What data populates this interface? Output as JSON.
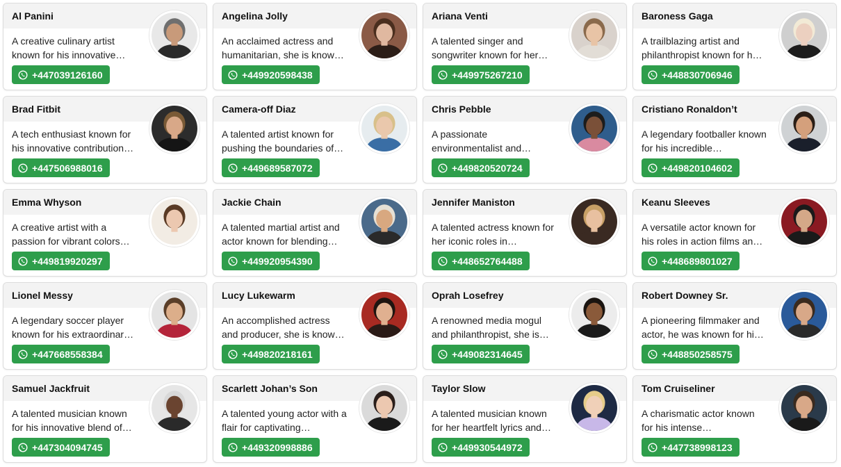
{
  "contacts": [
    {
      "name": "Al Panini",
      "description": "A creative culinary artist known for his innovative…",
      "phone": "+447039126160",
      "avatar_bg": "#e8e8e8",
      "skin": "#c89a7a",
      "hair": "#6f6f6f",
      "shirt": "#2a2a2a"
    },
    {
      "name": "Angelina Jolly",
      "description": "An acclaimed actress and humanitarian, she is know…",
      "phone": "+449920598438",
      "avatar_bg": "#8a5a46",
      "skin": "#e0b8a0",
      "hair": "#4a2e1e",
      "shirt": "#2b1d17"
    },
    {
      "name": "Ariana Venti",
      "description": "A talented singer and songwriter known for her…",
      "phone": "+449975267210",
      "avatar_bg": "#d9d2cc",
      "skin": "#e8c4a6",
      "hair": "#8a6a4c",
      "shirt": "#e2ddd6"
    },
    {
      "name": "Baroness Gaga",
      "description": "A trailblazing artist and philanthropist known for h…",
      "phone": "+448830706946",
      "avatar_bg": "#cfcfcf",
      "skin": "#ecd0c0",
      "hair": "#f2ead6",
      "shirt": "#1c1c1c"
    },
    {
      "name": "Brad Fitbit",
      "description": "A tech enthusiast known for his innovative contribution…",
      "phone": "+447506988016",
      "avatar_bg": "#2c2c2c",
      "skin": "#d8a888",
      "hair": "#7a5a36",
      "shirt": "#151515"
    },
    {
      "name": "Camera-off Diaz",
      "description": "A talented artist known for pushing the boundaries of…",
      "phone": "+449689587072",
      "avatar_bg": "#e6ecef",
      "skin": "#eac8ac",
      "hair": "#d8c08a",
      "shirt": "#3a6ea5"
    },
    {
      "name": "Chris Pebble",
      "description": "A passionate environmentalist and…",
      "phone": "+449820520724",
      "avatar_bg": "#2f5d8c",
      "skin": "#7a5038",
      "hair": "#1c1c1c",
      "shirt": "#d98aa0"
    },
    {
      "name": "Cristiano Ronaldon’t",
      "description": "A legendary footballer known for his incredible…",
      "phone": "+449820104602",
      "avatar_bg": "#cfd2d4",
      "skin": "#d4a07c",
      "hair": "#2a1e16",
      "shirt": "#1a1f2b"
    },
    {
      "name": "Emma Whyson",
      "description": "A creative artist with a passion for vibrant colors…",
      "phone": "+449819920297",
      "avatar_bg": "#f2ece4",
      "skin": "#ecc8b0",
      "hair": "#5a3a24",
      "shirt": "#f2ece4"
    },
    {
      "name": "Jackie Chain",
      "description": "A talented martial artist and actor known for blending…",
      "phone": "+449920954390",
      "avatar_bg": "#4a6a8a",
      "skin": "#d8a880",
      "hair": "#e6e0d4",
      "shirt": "#2a2a2a"
    },
    {
      "name": "Jennifer Maniston",
      "description": "A talented actress known for her iconic roles in…",
      "phone": "+448652764488",
      "avatar_bg": "#3a2a22",
      "skin": "#e8c0a0",
      "hair": "#c8a066",
      "shirt": "#3a2a22"
    },
    {
      "name": "Keanu Sleeves",
      "description": "A versatile actor known for his roles in action films an…",
      "phone": "+448689801027",
      "avatar_bg": "#8a1a22",
      "skin": "#d4a888",
      "hair": "#1a1a1a",
      "shirt": "#1a1a1a"
    },
    {
      "name": "Lionel Messy",
      "description": "A legendary soccer player known for his extraordinar…",
      "phone": "+447668558384",
      "avatar_bg": "#e4e4e4",
      "skin": "#dcae8a",
      "hair": "#5a3e28",
      "shirt": "#b4243a"
    },
    {
      "name": "Lucy Lukewarm",
      "description": "An accomplished actress and producer, she is know…",
      "phone": "+449820218161",
      "avatar_bg": "#a82a22",
      "skin": "#e0b090",
      "hair": "#1e1410",
      "shirt": "#2a1a16"
    },
    {
      "name": "Oprah Losefrey",
      "description": "A renowned media mogul and philanthropist, she is…",
      "phone": "+449082314645",
      "avatar_bg": "#ececec",
      "skin": "#8a5a3a",
      "hair": "#1a1410",
      "shirt": "#1a1a1a"
    },
    {
      "name": "Robert Downey Sr.",
      "description": "A pioneering filmmaker and actor, he was known for hi…",
      "phone": "+448850258575",
      "avatar_bg": "#2a5a9a",
      "skin": "#d8a888",
      "hair": "#3a2a1e",
      "shirt": "#2a2a2a"
    },
    {
      "name": "Samuel Jackfruit",
      "description": "A talented musician known for his innovative blend of…",
      "phone": "+447304094745",
      "avatar_bg": "#e6e6e6",
      "skin": "#6a4430",
      "hair": "#d8d8d8",
      "shirt": "#2a2a2a"
    },
    {
      "name": "Scarlett Johan’s Son",
      "description": "A talented young actor with a flair for captivating…",
      "phone": "+449320998886",
      "avatar_bg": "#dadada",
      "skin": "#ecc8b0",
      "hair": "#2a1e1a",
      "shirt": "#1a1a1a"
    },
    {
      "name": "Taylor Slow",
      "description": "A talented musician known for her heartfelt lyrics and…",
      "phone": "+449930544972",
      "avatar_bg": "#1e2a44",
      "skin": "#f0d0b8",
      "hair": "#e6cc8a",
      "shirt": "#c8b8e8"
    },
    {
      "name": "Tom Cruiseliner",
      "description": "A charismatic actor known for his intense…",
      "phone": "+447738998123",
      "avatar_bg": "#2a3a4a",
      "skin": "#d8a888",
      "hair": "#3a2a1e",
      "shirt": "#1a1a1a"
    }
  ],
  "colors": {
    "phone_button": "#2e9e4b",
    "card_header": "#f3f3f3",
    "card_border": "#dcdcdc"
  },
  "icons": {
    "phone": "whatsapp-icon"
  }
}
